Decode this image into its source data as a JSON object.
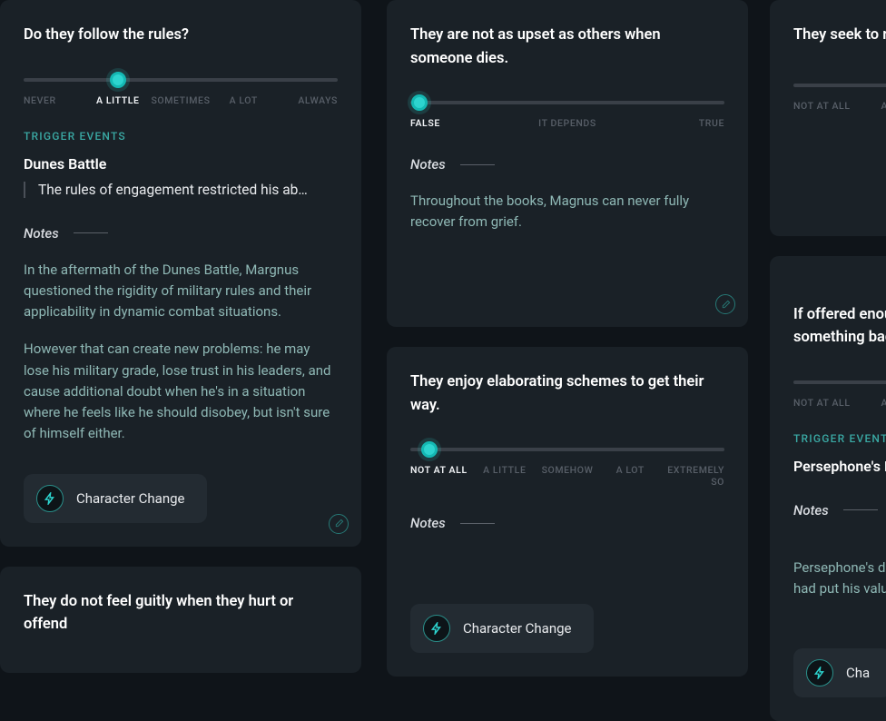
{
  "labels": {
    "trigger_events": "TRIGGER EVENTS",
    "notes": "Notes",
    "character_change": "Character Change"
  },
  "scales": {
    "frequency": [
      "NEVER",
      "A LITTLE",
      "SOMETIMES",
      "A LOT",
      "ALWAYS"
    ],
    "truth": [
      "FALSE",
      "IT DEPENDS",
      "TRUE"
    ],
    "degree": [
      "NOT AT ALL",
      "A LITTLE",
      "SOMEHOW",
      "A LOT",
      "EXTREMELY SO"
    ],
    "degree_partial": [
      "NOT AT ALL",
      "A LIT"
    ]
  },
  "cards": {
    "c1": {
      "question": "Do they follow the rules?",
      "selected_index": 1,
      "event_title": "Dunes Battle",
      "event_desc": "The rules of engagement restricted his ab…",
      "notes_p1": "In the aftermath of the Dunes Battle, Margnus questioned the rigidity of military rules and their applicability in dynamic combat situations.",
      "notes_p2": "However that can create new problems: he may lose his military grade, lose trust in his leaders, and cause additional doubt when he's in a situation where he feels like he should disobey, but isn't sure of himself either."
    },
    "c2": {
      "question": "They do not feel guitly when they hurt or offend"
    },
    "c3": {
      "question": "They are not as upset as others when someone dies.",
      "selected_index": 0,
      "notes": "Throughout the books, Magnus can never fully recover from grief."
    },
    "c4": {
      "question": "They enjoy elaborating schemes to get their way.",
      "selected_index": 0
    },
    "c5": {
      "question": "They seek to rep community in so"
    },
    "c6": {
      "question": "If offered enoug something bad?",
      "event_title": "Persephone's De",
      "notes": "Persephone's de had put his value"
    }
  }
}
